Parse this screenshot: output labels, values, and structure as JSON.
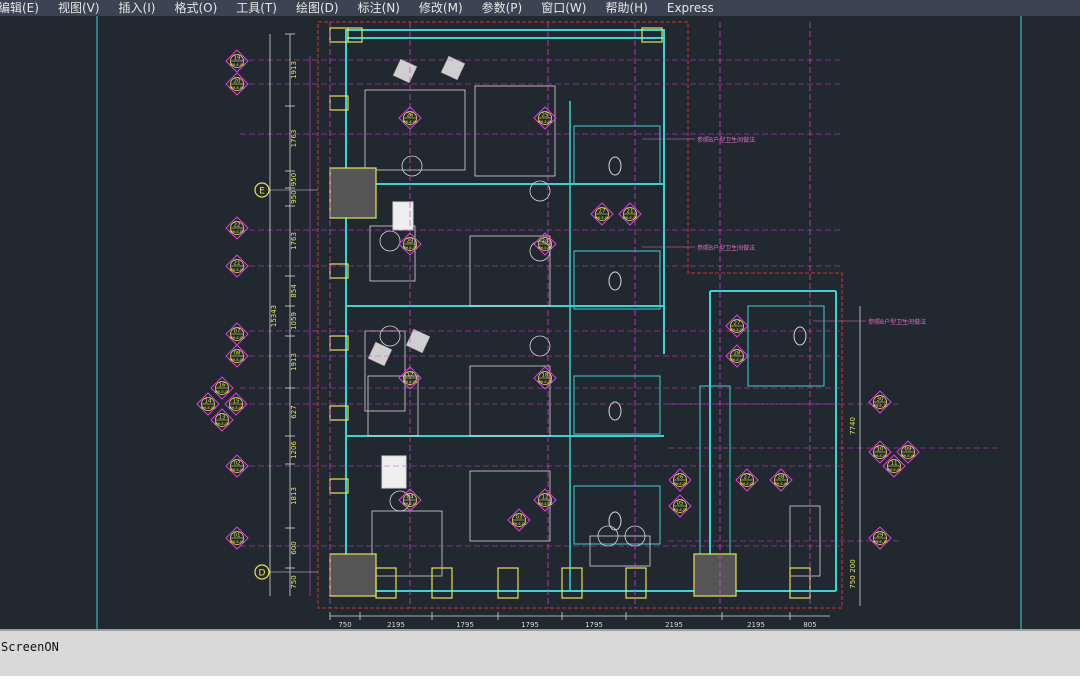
{
  "menu": [
    "编辑(E)",
    "视图(V)",
    "插入(I)",
    "格式(O)",
    "工具(T)",
    "绘图(D)",
    "标注(N)",
    "修改(M)",
    "参数(P)",
    "窗口(W)",
    "帮助(H)",
    "Express"
  ],
  "command_line": {
    "text": "ScreenON"
  },
  "drawing": {
    "grid_bubbles": [
      "E",
      "D"
    ],
    "bottom_dims": [
      "750",
      "2195",
      "1795",
      "1795",
      "1795",
      "2195",
      "2195",
      "805"
    ],
    "left_dims": [
      "1913",
      "1763",
      "950",
      "950",
      "1763",
      "854",
      "1059",
      "1913",
      "627",
      "1206",
      "1813",
      "600",
      "750"
    ],
    "left_total": "15343",
    "right_dims": [
      "7740",
      "750",
      "200"
    ],
    "annotations": [
      "参照B户型卫生间做法",
      "参照B户型卫生间做法",
      "参照B户型卫生间做法"
    ],
    "left_tags": [
      {
        "num": "19",
        "code": "MH-E-09"
      },
      {
        "num": "20",
        "code": "MH-E-06"
      },
      {
        "num": "22",
        "code": "MH-E-07"
      },
      {
        "num": "21",
        "code": "MH-E-07"
      },
      {
        "num": "07",
        "code": "MH-E-03"
      },
      {
        "num": "08",
        "code": "MH-E-04"
      },
      {
        "num": "16",
        "code": "MH-E-08"
      },
      {
        "num": "14",
        "code": "MH-E-08"
      },
      {
        "num": "15",
        "code": "MH-E-08"
      },
      {
        "num": "13",
        "code": "MH-E-05"
      },
      {
        "num": "02",
        "code": "MH-E-01"
      },
      {
        "num": "01",
        "code": "MH-E-01"
      }
    ],
    "room_tags": [
      {
        "num": "26",
        "code": "MH-E-08"
      },
      {
        "num": "25",
        "code": "MH-E-08"
      },
      {
        "num": "23",
        "code": "MH-E-07"
      },
      {
        "num": "24",
        "code": "MH-E-07"
      },
      {
        "num": "27",
        "code": "MH-E-06"
      },
      {
        "num": "21",
        "code": "MH-E-06"
      },
      {
        "num": "17",
        "code": "MH-E-05"
      },
      {
        "num": "18",
        "code": "MH-E-05"
      },
      {
        "num": "04",
        "code": "MH-E-02"
      },
      {
        "num": "12",
        "code": "MH-E-04"
      },
      {
        "num": "03",
        "code": "MH-E-02"
      },
      {
        "num": "27",
        "code": "MH-E-06"
      },
      {
        "num": "28",
        "code": "MH-E-06"
      },
      {
        "num": "27",
        "code": "MH-E-06"
      },
      {
        "num": "28",
        "code": "MH-E-06"
      },
      {
        "num": "26",
        "code": "MH-E-05"
      },
      {
        "num": "05",
        "code": "MH-E-02"
      }
    ],
    "right_tags": [
      {
        "num": "30",
        "code": "MH-E-10"
      },
      {
        "num": "10",
        "code": "MH-E-06"
      },
      {
        "num": "09",
        "code": "MH-E-06"
      },
      {
        "num": "11",
        "code": "MH-E-04"
      },
      {
        "num": "29",
        "code": "MH-E-10"
      }
    ]
  },
  "colors": {
    "cyan": "#3fd0d0",
    "magenta": "#e040e0",
    "yellow": "#e8e05a",
    "red": "#d03030",
    "white": "#d8d8d8",
    "pink": "#e070c0",
    "menubar": "#3b4452",
    "bg": "#212830"
  }
}
